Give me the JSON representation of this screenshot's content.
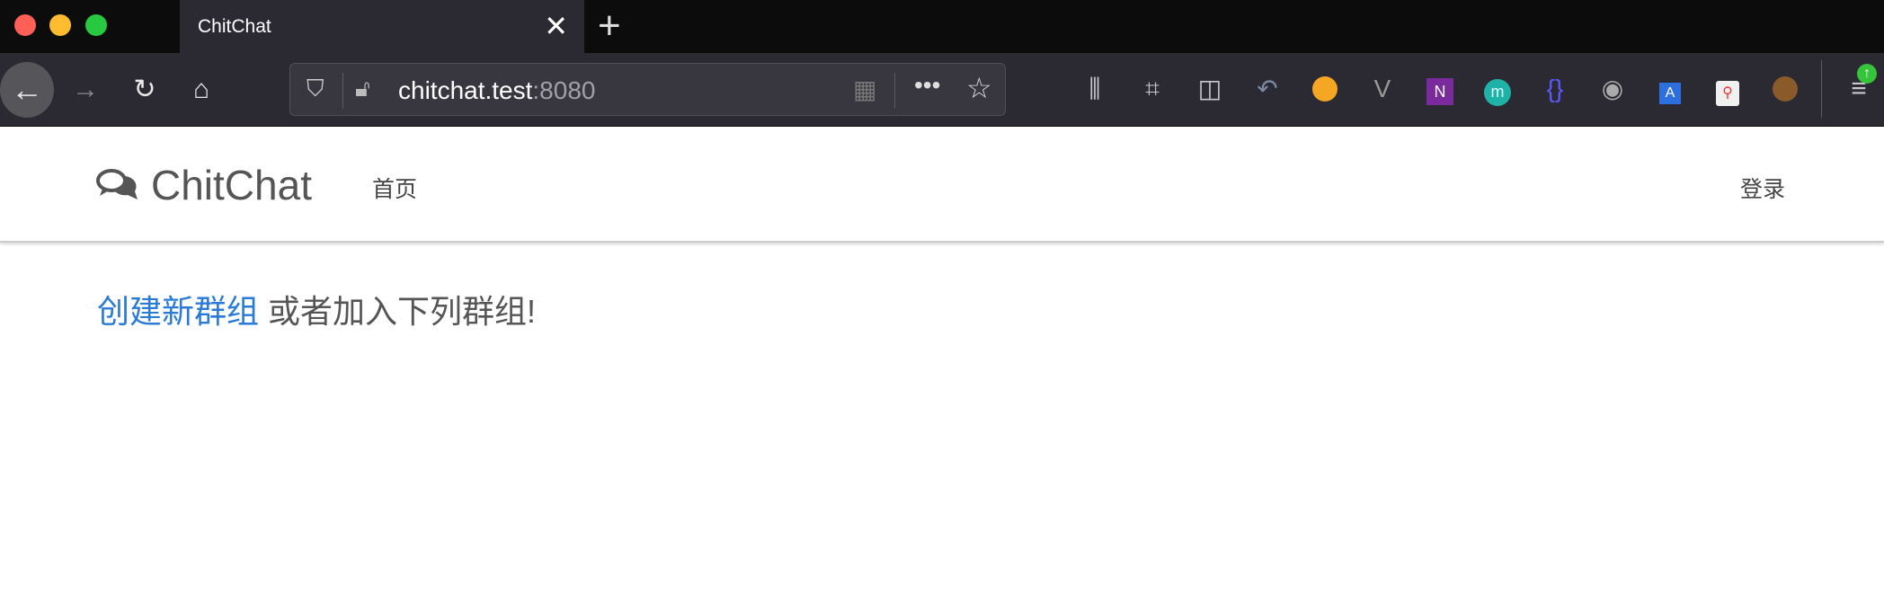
{
  "browser": {
    "tab_title": "ChitChat",
    "url_host": "chitchat.test",
    "url_port": ":8080",
    "traffic_lights": {
      "close": "#fe5f57",
      "minimize": "#febc2e",
      "maximize": "#28c840"
    },
    "toolbar_icons": [
      "back-icon",
      "forward-icon",
      "reload-icon",
      "home-icon"
    ],
    "extension_icons": [
      "library-icon",
      "crop-icon",
      "sidebar-icon",
      "undo-icon",
      "emoji-icon",
      "vue-icon",
      "onenote-icon",
      "m-icon",
      "json-icon",
      "account-icon",
      "translate-icon",
      "sitemap-icon",
      "cookie-icon"
    ]
  },
  "navbar": {
    "brand": "ChitChat",
    "home": "首页",
    "login": "登录"
  },
  "main": {
    "create_link": "创建新群组",
    "rest": " 或者加入下列群组!"
  },
  "colors": {
    "link": "#2a7ad8",
    "text": "#555555"
  }
}
